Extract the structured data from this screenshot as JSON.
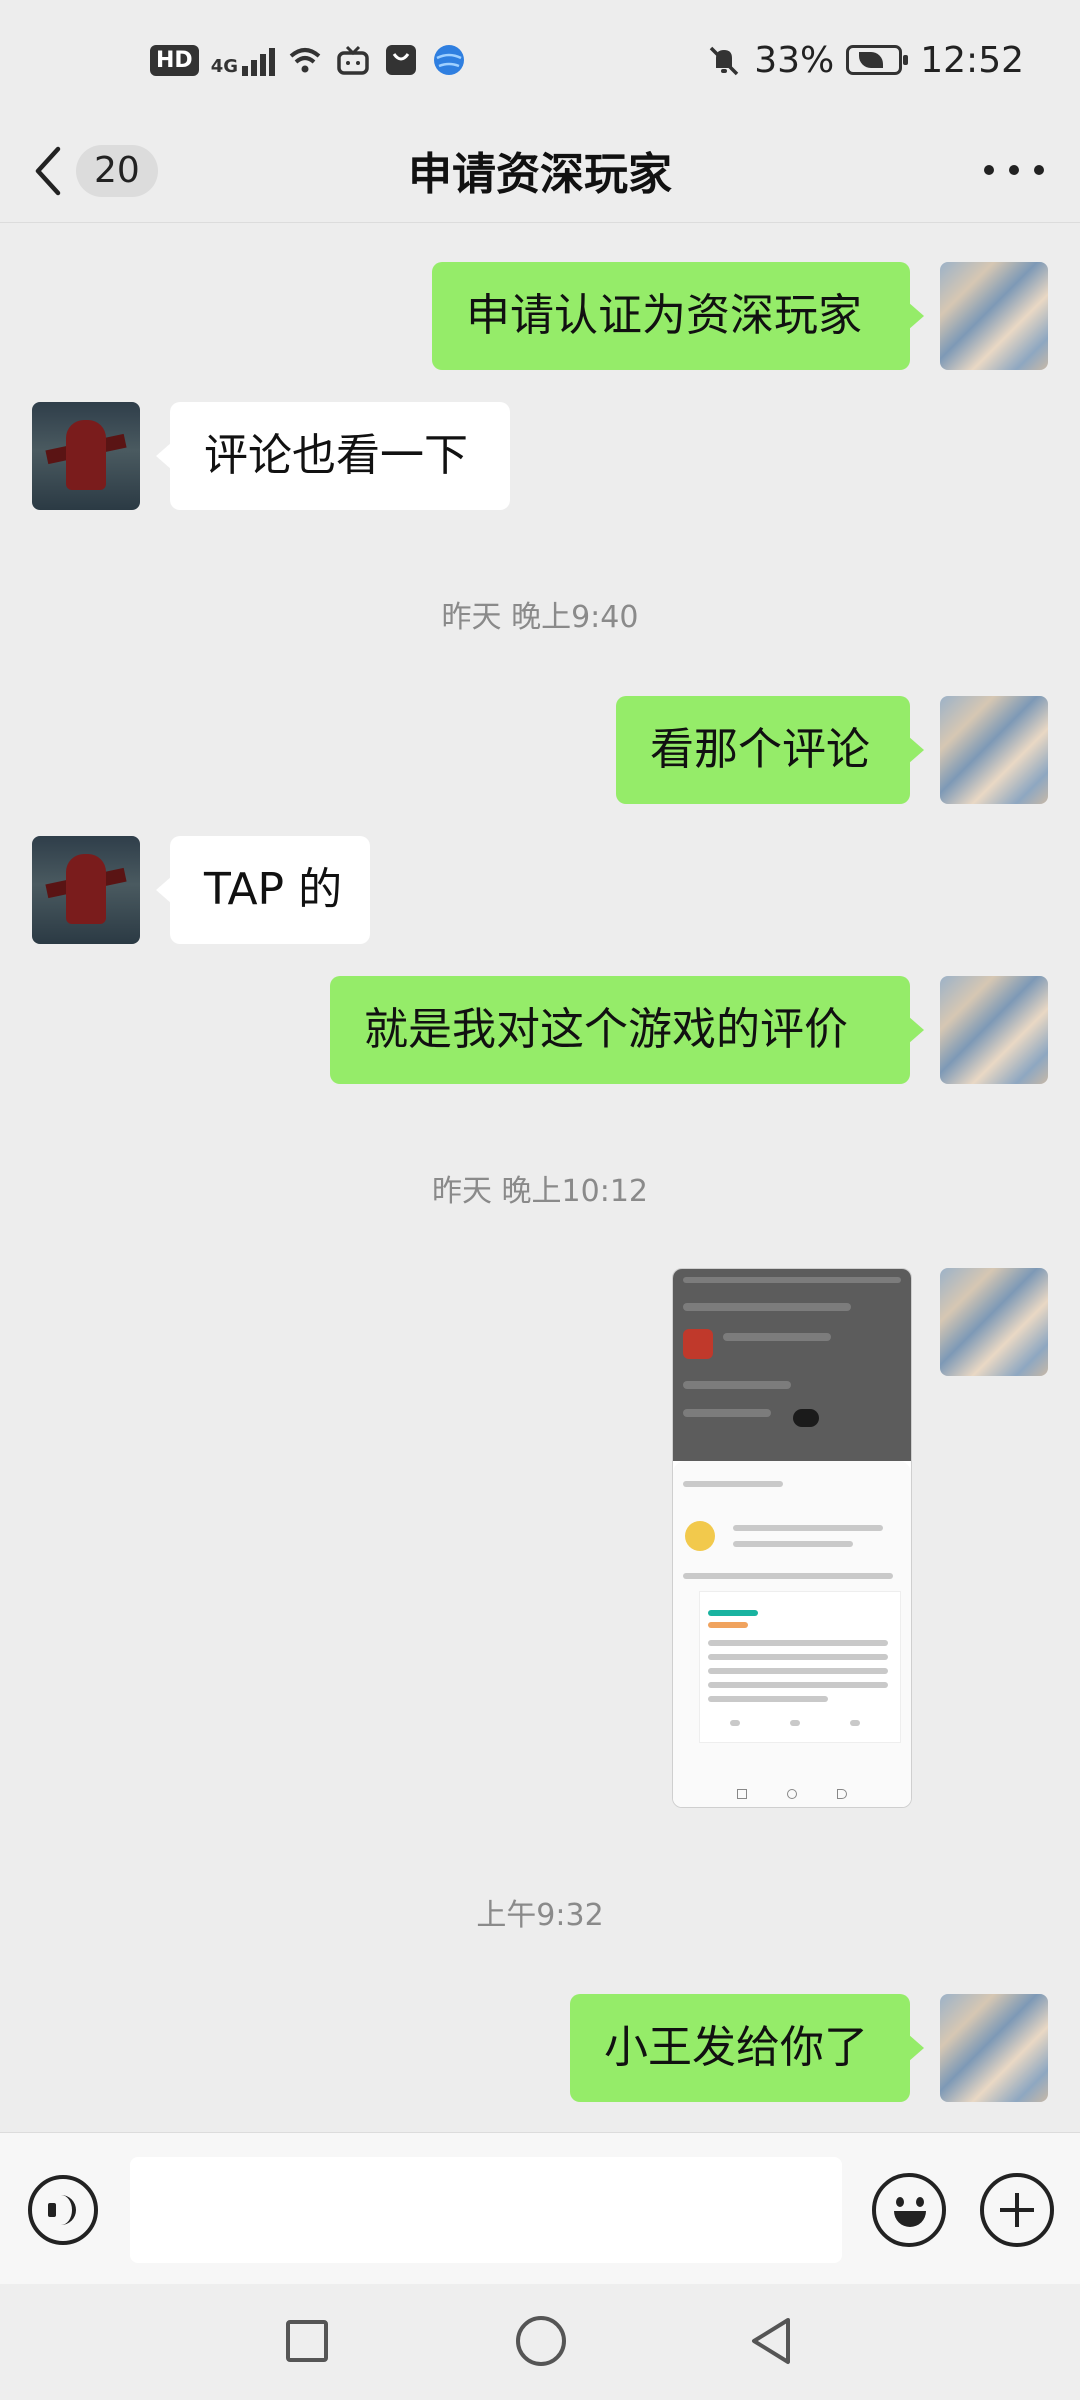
{
  "status_bar": {
    "hd": "HD",
    "network": "4G",
    "battery_percent": "33%",
    "time": "12:52",
    "icons": [
      "hd-icon",
      "signal-icon",
      "wifi-icon",
      "tv-icon",
      "store-icon",
      "browser-icon",
      "mute-icon",
      "battery-icon"
    ]
  },
  "header": {
    "unread_count": "20",
    "title": "申请资深玩家",
    "back_icon": "chevron-left-icon",
    "more_icon": "more-dots-icon"
  },
  "messages": [
    {
      "sender": "me",
      "text": "申请认证为资深玩家"
    },
    {
      "sender": "other",
      "text": "评论也看一下"
    },
    {
      "type": "time",
      "text": "昨天 晚上9:40"
    },
    {
      "sender": "me",
      "text": "看那个评论"
    },
    {
      "sender": "other",
      "text": "TAP 的"
    },
    {
      "sender": "me",
      "text": "就是我对这个游戏的评价"
    },
    {
      "type": "time",
      "text": "昨天 晚上10:12"
    },
    {
      "sender": "me",
      "type": "image",
      "text": ""
    },
    {
      "type": "time",
      "text": "上午9:32"
    },
    {
      "sender": "me",
      "text": "小王发给你了"
    }
  ],
  "input_bar": {
    "value": "",
    "voice_icon": "voice-icon",
    "emoji_icon": "emoji-icon",
    "plus_icon": "plus-icon"
  },
  "nav_bar": {
    "icons": [
      "recent-apps-icon",
      "home-icon",
      "back-icon"
    ]
  },
  "colors": {
    "background": "#ededed",
    "my_bubble": "#95ec69",
    "other_bubble": "#ffffff"
  }
}
